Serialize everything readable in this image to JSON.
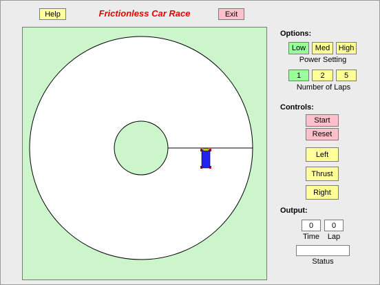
{
  "header": {
    "help_label": "Help",
    "title": "Frictionless Car Race",
    "exit_label": "Exit"
  },
  "options": {
    "heading": "Options:",
    "power_buttons": [
      "Low",
      "Med",
      "High"
    ],
    "power_caption": "Power Setting",
    "laps_buttons": [
      "1",
      "2",
      "5"
    ],
    "laps_caption": "Number of Laps"
  },
  "controls": {
    "heading": "Controls:",
    "start_label": "Start",
    "reset_label": "Reset",
    "left_label": "Left",
    "thrust_label": "Thrust",
    "right_label": "Right"
  },
  "output": {
    "heading": "Output:",
    "time_value": "0",
    "time_caption": "Time",
    "lap_value": "0",
    "lap_caption": "Lap",
    "status_value": "",
    "status_caption": "Status"
  },
  "colors": {
    "field_bg": "#ccf5cc",
    "track": "#ffffff",
    "selected_button": "#99ff99",
    "button": "#ffff99",
    "alert_button": "#ffc0cb",
    "title": "#e60000",
    "car_body": "#2222ee",
    "car_trim": "#cc0000"
  }
}
